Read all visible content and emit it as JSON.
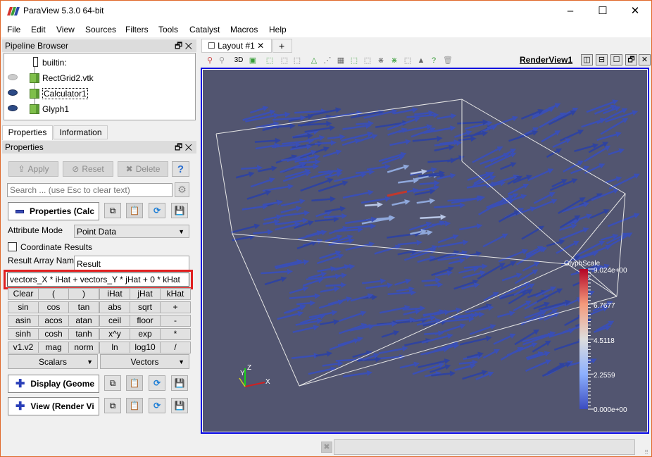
{
  "window": {
    "title": "ParaView 5.3.0 64-bit",
    "controls": {
      "minimize": "–",
      "maximize": "☐",
      "close": "✕"
    }
  },
  "menu": [
    "File",
    "Edit",
    "View",
    "Sources",
    "Filters",
    "Tools",
    "Catalyst",
    "Macros",
    "Help"
  ],
  "pipeline_browser": {
    "title": "Pipeline Browser",
    "items": [
      {
        "label": "builtin:",
        "icon": "server-icon",
        "eye": "none"
      },
      {
        "label": "RectGrid2.vtk",
        "icon": "cube-icon",
        "eye": "hidden"
      },
      {
        "label": "Calculator1",
        "icon": "cube-icon",
        "eye": "visible",
        "selected": true
      },
      {
        "label": "Glyph1",
        "icon": "cube-icon",
        "eye": "visible"
      }
    ]
  },
  "tabs": {
    "properties": "Properties",
    "information": "Information",
    "active": "Properties"
  },
  "properties_panel": {
    "title": "Properties",
    "apply": "Apply",
    "reset": "Reset",
    "delete": "Delete",
    "help": "?",
    "search_placeholder": "Search ... (use Esc to clear text)",
    "section_properties": "Properties (Calc",
    "attribute_mode_label": "Attribute Mode",
    "attribute_mode_value": "Point Data",
    "coordinate_results_label": "Coordinate Results",
    "coordinate_results_checked": false,
    "result_array_name_label": "Result Array Name",
    "result_array_name_value": "Result",
    "expression": "vectors_X * iHat + vectors_Y * jHat + 0 * kHat",
    "calculator_buttons": [
      [
        "Clear",
        "(",
        ")",
        "iHat",
        "jHat",
        "kHat"
      ],
      [
        "sin",
        "cos",
        "tan",
        "abs",
        "sqrt",
        "+"
      ],
      [
        "asin",
        "acos",
        "atan",
        "ceil",
        "floor",
        "-"
      ],
      [
        "sinh",
        "cosh",
        "tanh",
        "x^y",
        "exp",
        "*"
      ],
      [
        "v1.v2",
        "mag",
        "norm",
        "ln",
        "log10",
        "/"
      ]
    ],
    "scalars_label": "Scalars",
    "vectors_label": "Vectors",
    "section_display": "Display (Geome",
    "section_view": "View (Render Vi"
  },
  "layout": {
    "tab_label": "Layout #1",
    "add_tab": "+",
    "toolbar_3d": "3D",
    "render_view_title": "RenderView1",
    "highlight_color": "#e02020"
  },
  "render_view": {
    "background": "#525570",
    "colorbar": {
      "title": "GlyphScale",
      "labels": [
        "9.024e+00",
        "6.7677",
        "4.5118",
        "2.2559",
        "0.000e+00"
      ],
      "range": [
        0,
        9.024
      ]
    },
    "axes": {
      "x": "X",
      "y": "Y",
      "z": "Z"
    }
  }
}
